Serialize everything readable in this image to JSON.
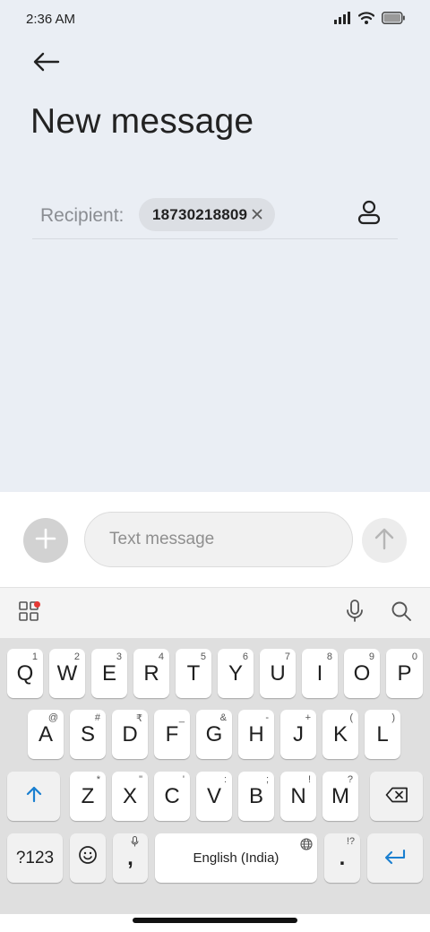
{
  "status_bar": {
    "time": "2:36 AM",
    "icons": [
      "signal-icon",
      "wifi-icon",
      "battery-icon"
    ]
  },
  "header": {
    "back_icon": "arrow-left-icon",
    "title": "New message"
  },
  "recipient": {
    "label": "Recipient:",
    "chips": [
      {
        "text": "18730218809",
        "remove_icon": "close-icon"
      }
    ],
    "contact_icon": "person-icon"
  },
  "compose": {
    "add_icon": "plus-icon",
    "placeholder": "Text message",
    "value": "",
    "send_icon": "arrow-up-icon"
  },
  "keyboard_toolbar": {
    "left_icon": "apps-grid-icon",
    "has_notification_dot": true,
    "right_icons": [
      "microphone-icon",
      "search-icon"
    ]
  },
  "keyboard": {
    "row1": [
      {
        "label": "Q",
        "hint": "1"
      },
      {
        "label": "W",
        "hint": "2"
      },
      {
        "label": "E",
        "hint": "3"
      },
      {
        "label": "R",
        "hint": "4"
      },
      {
        "label": "T",
        "hint": "5"
      },
      {
        "label": "Y",
        "hint": "6"
      },
      {
        "label": "U",
        "hint": "7"
      },
      {
        "label": "I",
        "hint": "8"
      },
      {
        "label": "O",
        "hint": "9"
      },
      {
        "label": "P",
        "hint": "0"
      }
    ],
    "row2": [
      {
        "label": "A",
        "hint": "@"
      },
      {
        "label": "S",
        "hint": "#"
      },
      {
        "label": "D",
        "hint": "₹"
      },
      {
        "label": "F",
        "hint": "_"
      },
      {
        "label": "G",
        "hint": "&"
      },
      {
        "label": "H",
        "hint": "-"
      },
      {
        "label": "J",
        "hint": "+"
      },
      {
        "label": "K",
        "hint": "("
      },
      {
        "label": "L",
        "hint": ")"
      }
    ],
    "row3": [
      {
        "label": "Z",
        "hint": "*"
      },
      {
        "label": "X",
        "hint": "\""
      },
      {
        "label": "C",
        "hint": "'"
      },
      {
        "label": "V",
        "hint": ":"
      },
      {
        "label": "B",
        "hint": ";"
      },
      {
        "label": "N",
        "hint": "!"
      },
      {
        "label": "M",
        "hint": "?"
      }
    ],
    "shift_icon": "shift-arrow-icon",
    "backspace_icon": "backspace-icon",
    "symbols_label": "?123",
    "emoji_icon": "emoji-icon",
    "comma": {
      "label": ",",
      "hint_icon": "microphone-icon"
    },
    "space_label": "English (India)",
    "space_hint_icon": "globe-icon",
    "period": {
      "label": ".",
      "hint": "!?"
    },
    "enter_icon": "enter-icon"
  }
}
